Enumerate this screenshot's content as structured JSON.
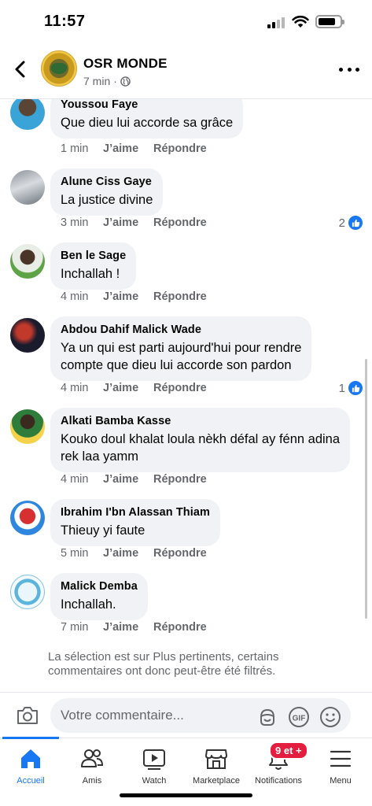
{
  "status_bar": {
    "time": "11:57"
  },
  "header": {
    "page_name": "OSR MONDE",
    "post_time": "7 min",
    "separator": "·"
  },
  "comments": [
    {
      "author": "Youssou Faye",
      "text": "Que dieu lui accorde sa grâce",
      "time": "1 min",
      "like": "J’aime",
      "reply": "Répondre",
      "reactions": ""
    },
    {
      "author": "Alune Ciss Gaye",
      "text": "La justice divine",
      "time": "3 min",
      "like": "J’aime",
      "reply": "Répondre",
      "reactions": "2"
    },
    {
      "author": "Ben le Sage",
      "text": "Inchallah !",
      "time": "4 min",
      "like": "J’aime",
      "reply": "Répondre",
      "reactions": ""
    },
    {
      "author": "Abdou Dahif Malick Wade",
      "text_line1": "Ya un qui est parti aujourd'hui pour rendre",
      "text_line2": "compte que dieu lui accorde son pardon",
      "time": "4 min",
      "like": "J’aime",
      "reply": "Répondre",
      "reactions": "1"
    },
    {
      "author": "Alkati Bamba Kasse",
      "text_line1": "Kouko doul khalat loula nèkh défal ay fénn adina",
      "text_line2": "rek laa yamm",
      "time": "4 min",
      "like": "J’aime",
      "reply": "Répondre",
      "reactions": ""
    },
    {
      "author": "Ibrahim I'bn Alassan Thiam",
      "text": "Thieuy yi faute",
      "time": "5 min",
      "like": "J’aime",
      "reply": "Répondre",
      "reactions": ""
    },
    {
      "author": "Malick Demba",
      "text": "Inchallah.",
      "time": "7 min",
      "like": "J’aime",
      "reply": "Répondre",
      "reactions": ""
    }
  ],
  "filter_note": {
    "line1": "La sélection est sur Plus pertinents, certains",
    "line2": "commentaires ont donc peut-être été filtrés."
  },
  "composer": {
    "placeholder": "Votre commentaire..."
  },
  "tabbar": {
    "tabs": [
      {
        "label": "Accueil",
        "icon": "home-icon"
      },
      {
        "label": "Amis",
        "icon": "friends-icon"
      },
      {
        "label": "Watch",
        "icon": "watch-icon"
      },
      {
        "label": "Marketplace",
        "icon": "marketplace-icon"
      },
      {
        "label": "Notifications",
        "icon": "bell-icon"
      },
      {
        "label": "Menu",
        "icon": "menu-icon"
      }
    ],
    "notification_badge": "9 et +"
  },
  "colors": {
    "accent": "#1877f2",
    "bubble": "#f0f2f5",
    "secondary_text": "#65676b",
    "badge": "#e41e3f"
  }
}
